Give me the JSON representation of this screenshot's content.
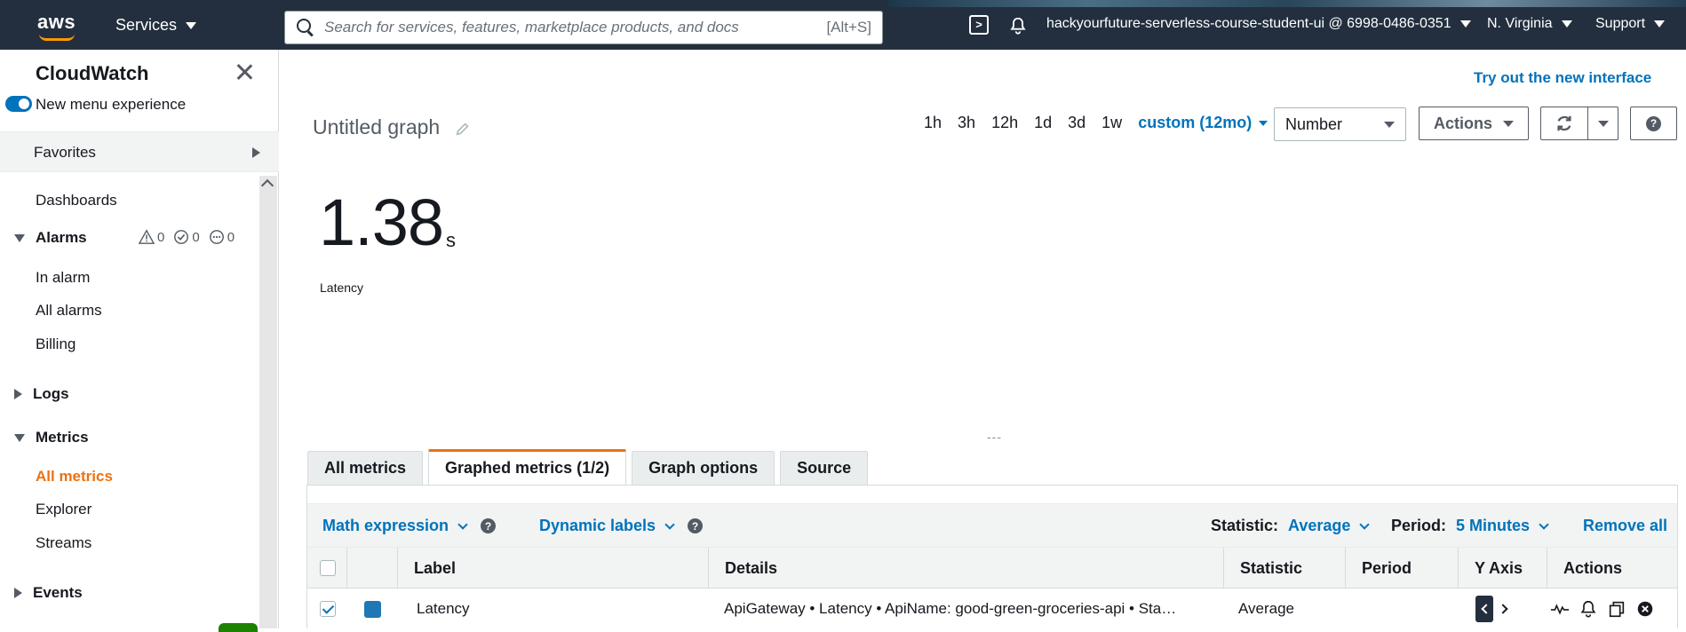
{
  "topnav": {
    "logo": "aws",
    "services": "Services",
    "search_placeholder": "Search for services, features, marketplace products, and docs",
    "search_shortcut": "[Alt+S]",
    "account": "hackyourfuture-serverless-course-student-ui @ 6998-0486-0351",
    "region": "N. Virginia",
    "support": "Support"
  },
  "sidebar": {
    "title": "CloudWatch",
    "toggle_label": "New menu experience",
    "favorites": "Favorites",
    "dashboards": "Dashboards",
    "alarms": {
      "label": "Alarms",
      "in_alarm_count": "0",
      "ok_count": "0",
      "insufficient_count": "0",
      "items": [
        "In alarm",
        "All alarms",
        "Billing"
      ]
    },
    "logs": "Logs",
    "metrics": {
      "label": "Metrics",
      "items": [
        "All metrics",
        "Explorer",
        "Streams"
      ]
    },
    "events": "Events"
  },
  "main": {
    "try_new": "Try out the new interface",
    "graph_title": "Untitled graph",
    "time_ranges": [
      "1h",
      "3h",
      "12h",
      "1d",
      "3d",
      "1w"
    ],
    "custom_range": "custom (12mo)",
    "view_type": "Number",
    "actions": "Actions",
    "big_value": "1.38",
    "big_unit": "s",
    "metric_label": "Latency",
    "drag_handle": "---"
  },
  "tabs": [
    "All metrics",
    "Graphed metrics (1/2)",
    "Graph options",
    "Source"
  ],
  "toolbar": {
    "math_expression": "Math expression",
    "dynamic_labels": "Dynamic labels",
    "statistic_label": "Statistic:",
    "statistic_value": "Average",
    "period_label": "Period:",
    "period_value": "5 Minutes",
    "remove_all": "Remove all"
  },
  "table": {
    "headers": [
      "Label",
      "Details",
      "Statistic",
      "Period",
      "Y Axis",
      "Actions"
    ],
    "rows": [
      {
        "label": "Latency",
        "details": "ApiGateway • Latency • ApiName: good-green-groceries-api • Sta…",
        "statistic": "Average",
        "period": "",
        "color": "#1f77b4"
      }
    ]
  },
  "colors": {
    "nav_bg": "#232f3e",
    "accent_orange": "#ec7211",
    "link_blue": "#0073bb"
  }
}
